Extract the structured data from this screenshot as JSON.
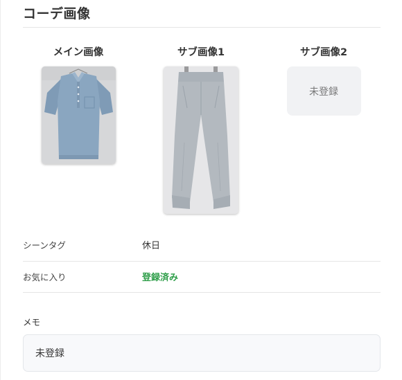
{
  "section": {
    "title": "コーデ画像"
  },
  "images": {
    "main": {
      "label": "メイン画像"
    },
    "sub1": {
      "label": "サブ画像1"
    },
    "sub2": {
      "label": "サブ画像2",
      "placeholder": "未登録"
    }
  },
  "info": {
    "scene_tag": {
      "key": "シーンタグ",
      "value": "休日"
    },
    "favorite": {
      "key": "お気に入り",
      "value": "登録済み"
    }
  },
  "memo": {
    "label": "メモ",
    "value": "未登録"
  },
  "colors": {
    "favorite_status": "#2e9e49"
  }
}
